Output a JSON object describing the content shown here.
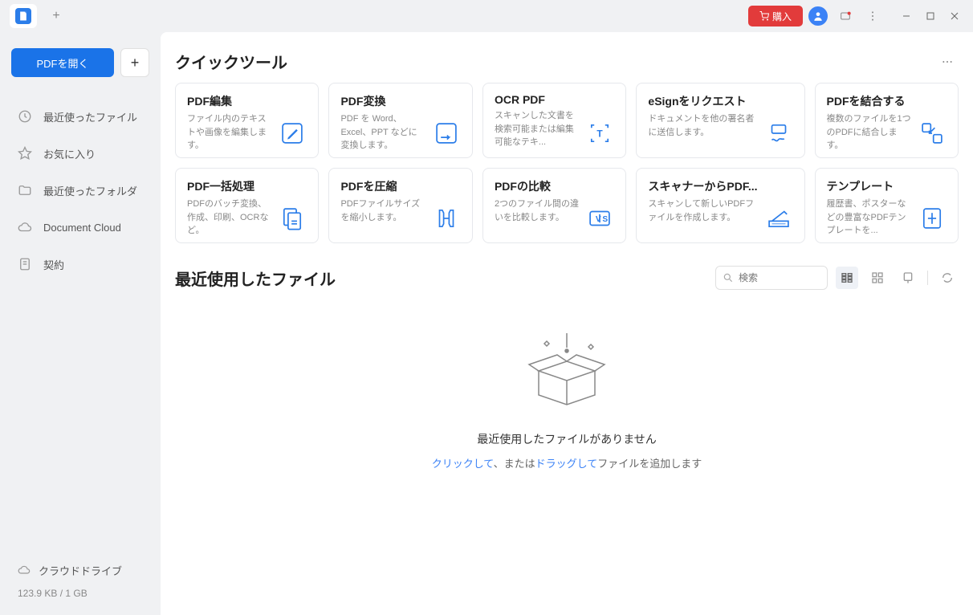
{
  "titlebar": {
    "buy_label": "購入"
  },
  "sidebar": {
    "open_label": "PDFを開く",
    "items": [
      {
        "label": "最近使ったファイル"
      },
      {
        "label": "お気に入り"
      },
      {
        "label": "最近使ったフォルダ"
      },
      {
        "label": "Document Cloud"
      },
      {
        "label": "契約"
      }
    ],
    "cloud_drive_label": "クラウドドライブ",
    "storage_usage": "123.9 KB / 1 GB"
  },
  "quick_tools": {
    "title": "クイックツール",
    "cards": [
      {
        "title": "PDF編集",
        "desc": "ファイル内のテキストや画像を編集します。"
      },
      {
        "title": "PDF変換",
        "desc": "PDF を Word、Excel、PPT などに変換します。"
      },
      {
        "title": "OCR PDF",
        "desc": "スキャンした文書を検索可能または編集可能なテキ..."
      },
      {
        "title": "eSignをリクエスト",
        "desc": "ドキュメントを他の署名者に送信します。"
      },
      {
        "title": "PDFを結合する",
        "desc": "複数のファイルを1つのPDFに結合します。"
      },
      {
        "title": "PDF一括処理",
        "desc": "PDFのバッチ変換、作成、印刷、OCRなど。"
      },
      {
        "title": "PDFを圧縮",
        "desc": "PDFファイルサイズを縮小します。"
      },
      {
        "title": "PDFの比較",
        "desc": "2つのファイル間の違いを比較します。"
      },
      {
        "title": "スキャナーからPDF...",
        "desc": "スキャンして新しいPDFファイルを作成します。"
      },
      {
        "title": "テンプレート",
        "desc": "履歴書、ポスターなどの豊富なPDFテンプレートを..."
      }
    ]
  },
  "recent": {
    "title": "最近使用したファイル",
    "search_placeholder": "検索",
    "empty_title": "最近使用したファイルがありません",
    "empty_click": "クリックして",
    "empty_sep": "、または",
    "empty_drag": "ドラッグして",
    "empty_tail": "ファイルを追加します"
  }
}
